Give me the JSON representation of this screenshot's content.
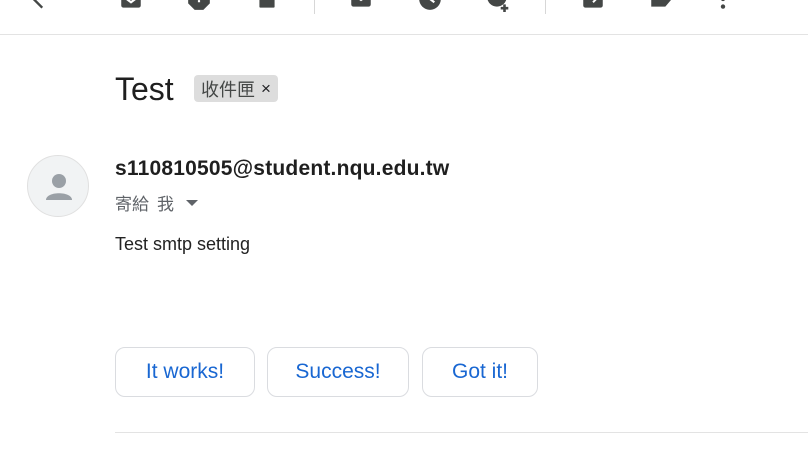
{
  "toolbar": {
    "icons": [
      "back-arrow-icon",
      "archive-icon",
      "report-spam-icon",
      "delete-icon",
      "mark-unread-icon",
      "snooze-icon",
      "add-to-tasks-icon",
      "move-to-icon",
      "label-icon",
      "more-vert-icon"
    ]
  },
  "message": {
    "subject": "Test",
    "label": "收件匣",
    "label_close": "×",
    "sender": "s110810505@student.nqu.edu.tw",
    "to_prefix": "寄給",
    "to_value": "我",
    "body": "Test smtp setting"
  },
  "smart_replies": [
    "It works!",
    "Success!",
    "Got it!"
  ],
  "colors": {
    "reply_text": "#1967d2",
    "chip_bg": "#dddddd",
    "divider": "#e3e3e3"
  }
}
